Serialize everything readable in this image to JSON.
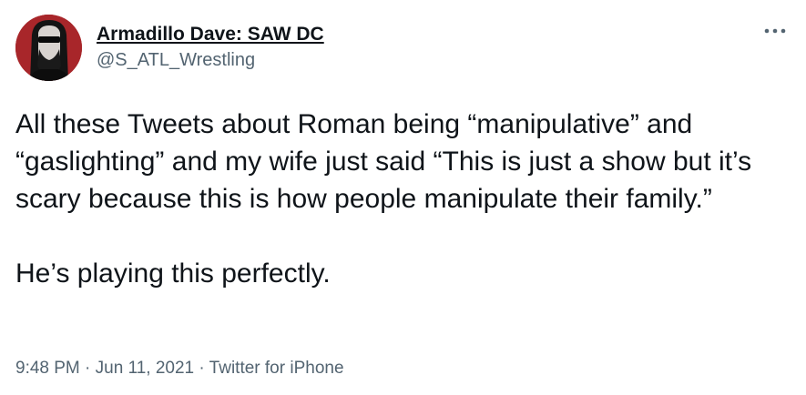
{
  "author": {
    "display_name": "Armadillo Dave: SAW DC",
    "handle": "@S_ATL_Wrestling",
    "avatar_icon": "profile-avatar",
    "avatar_bg_color": "#a52a2a"
  },
  "menu": {
    "icon": "more-options-icon"
  },
  "tweet": {
    "paragraphs": [
      "All these Tweets about Roman being “manipulative” and “gaslighting” and my wife just said “This is just a show but it’s scary because this is how people manipulate their family.”",
      "He’s playing this perfectly."
    ]
  },
  "meta": {
    "time": "9:48 PM",
    "separator": " · ",
    "date": "Jun 11, 2021",
    "source": "Twitter for iPhone"
  },
  "colors": {
    "text_primary": "#0f1419",
    "text_secondary": "#536471"
  }
}
